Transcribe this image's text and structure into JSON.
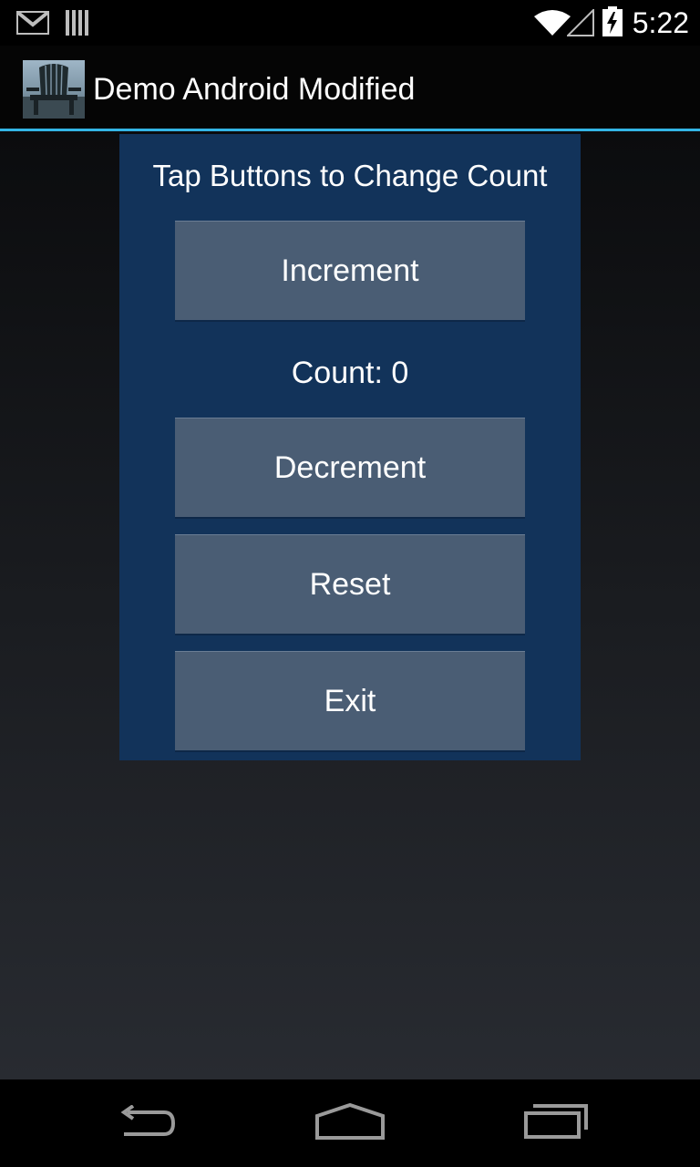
{
  "status_bar": {
    "time": "5:22",
    "icons": [
      "gmail-icon",
      "signal-bars-icon",
      "wifi-icon",
      "cell-signal-icon",
      "battery-charging-icon"
    ]
  },
  "action_bar": {
    "title": "Demo Android Modified",
    "app_icon": "adirondack-chair-icon"
  },
  "panel": {
    "title": "Tap Buttons to Change Count",
    "increment_label": "Increment",
    "count_label": "Count: 0",
    "decrement_label": "Decrement",
    "reset_label": "Reset",
    "exit_label": "Exit"
  },
  "nav_bar": {
    "icons": [
      "back-icon",
      "home-icon",
      "recent-apps-icon"
    ]
  },
  "colors": {
    "accent": "#33b5e5",
    "panel_background": "#12335a",
    "button_background": "#4a5d74"
  }
}
